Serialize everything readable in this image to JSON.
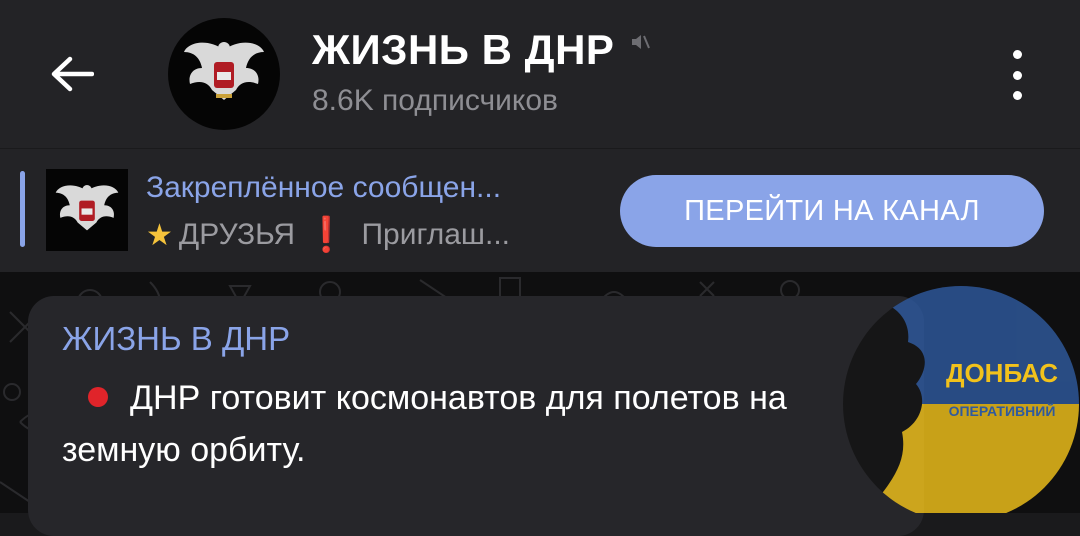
{
  "header": {
    "back_icon": "back-arrow-icon",
    "title": "ЖИЗНЬ В ДНР",
    "subtitle": "8.6K подписчиков",
    "mute_icon": "muted-speaker-icon",
    "menu_icon": "more-vertical-icon"
  },
  "pinned": {
    "title": "Закреплённое сообщен...",
    "text_part1": "ДРУЗЬЯ",
    "text_part2": "Приглаш...",
    "star_icon": "star-emoji-icon",
    "exclamation": "❗",
    "button_label": "ПЕРЕЙТИ НА КАНАЛ"
  },
  "message": {
    "sender": "ЖИЗНЬ В ДНР",
    "text": "ДНР готовит космонавтов для полетов на земную орбиту."
  },
  "watermark": {
    "line1": "ДОНБАС",
    "line2": "ОПЕРАТИВНИЙ"
  },
  "colors": {
    "accent": "#8aa4e8",
    "header_bg": "#232326",
    "bubble_bg": "#26262a",
    "red": "#e0242a",
    "watermark_blue": "#2f5a9e",
    "watermark_yellow": "#f2c21b"
  }
}
